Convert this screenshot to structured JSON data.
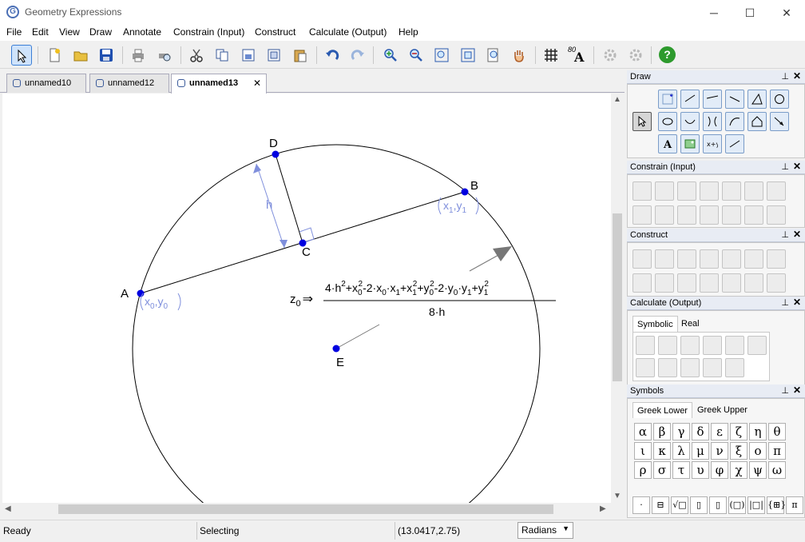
{
  "window": {
    "title": "Geometry Expressions",
    "app_icon_letter": "G",
    "minimize": "─",
    "maximize": "☐",
    "close": "✕"
  },
  "menu": [
    "File",
    "Edit",
    "View",
    "Draw",
    "Annotate",
    "Constrain (Input)",
    "Construct",
    "Calculate (Output)",
    "Help"
  ],
  "toolbar": {
    "buttons": [
      "select-arrow-icon",
      "new-file-icon",
      "open-folder-icon",
      "save-disk-icon",
      "print-icon",
      "print-preview-icon",
      "cut-scissors-icon",
      "copy-icon",
      "copy-drawing-icon",
      "copy-expression-icon",
      "paste-icon",
      "undo-icon",
      "redo-icon",
      "zoom-in-icon",
      "zoom-out-icon",
      "zoom-box-icon",
      "zoom-fit-icon",
      "zoom-page-icon",
      "pan-hand-icon",
      "grid-icon",
      "font-style-icon",
      "gear-icon",
      "gear-alt-icon",
      "help-icon"
    ],
    "grid_label": "80",
    "help_glyph": "?"
  },
  "tabs": [
    {
      "label": "unnamed10",
      "active": false
    },
    {
      "label": "unnamed12",
      "active": false
    },
    {
      "label": "unnamed13",
      "active": true
    }
  ],
  "tab_close": "✕",
  "canvas": {
    "points": [
      {
        "label": "A",
        "coord": [
          "x",
          "0",
          "y",
          "0"
        ]
      },
      {
        "label": "B",
        "coord": [
          "x",
          "1",
          "y",
          "1"
        ]
      },
      {
        "label": "C"
      },
      {
        "label": "D"
      },
      {
        "label": "E"
      }
    ],
    "height_label": "h",
    "result": {
      "lhs_main": "z",
      "lhs_sub": "0",
      "arrow": "⇒",
      "numerator_parts": [
        {
          "t": "4·h"
        },
        {
          "sup": "2"
        },
        {
          "t": "+x"
        },
        {
          "sub": "0"
        },
        {
          "sup": "2"
        },
        {
          "t": "-2·x"
        },
        {
          "sub": "0"
        },
        {
          "t": "·x"
        },
        {
          "sub": "1"
        },
        {
          "t": "+x"
        },
        {
          "sub": "1"
        },
        {
          "sup": "2"
        },
        {
          "t": "+y"
        },
        {
          "sub": "0"
        },
        {
          "sup": "2"
        },
        {
          "t": "-2·y"
        },
        {
          "sub": "0"
        },
        {
          "t": "·y"
        },
        {
          "sub": "1"
        },
        {
          "t": "+y"
        },
        {
          "sub": "1"
        },
        {
          "sup": "2"
        }
      ],
      "denominator": "8·h"
    }
  },
  "panels": {
    "draw": {
      "title": "Draw"
    },
    "constrain": {
      "title": "Constrain (Input)"
    },
    "construct": {
      "title": "Construct"
    },
    "calculate": {
      "title": "Calculate (Output)",
      "tabs": [
        "Symbolic",
        "Real"
      ]
    },
    "symbols": {
      "title": "Symbols",
      "tabs": [
        "Greek Lower",
        "Greek Upper"
      ],
      "rows": [
        [
          "α",
          "β",
          "γ",
          "δ",
          "ε",
          "ζ",
          "η",
          "θ"
        ],
        [
          "ι",
          "κ",
          "λ",
          "μ",
          "ν",
          "ξ",
          "ο",
          "π"
        ],
        [
          "ρ",
          "σ",
          "τ",
          "υ",
          "φ",
          "χ",
          "ψ",
          "ω"
        ]
      ],
      "templates": [
        "·",
        "⊟",
        "√□",
        "▯",
        "▯",
        "(□)",
        "|□|",
        "{⊞}",
        "π"
      ]
    },
    "pin_glyph": "⊥",
    "close_glyph": "✕"
  },
  "status": {
    "ready": "Ready",
    "mode": "Selecting",
    "coords": "(13.0417,2.75)",
    "angle_mode": "Radians",
    "dropdown_glyph": "▼"
  },
  "colors": {
    "point": "#0000e0",
    "annotation": "#7f8fdc",
    "accent": "#3c7fd6",
    "help": "#2d9a2d"
  }
}
